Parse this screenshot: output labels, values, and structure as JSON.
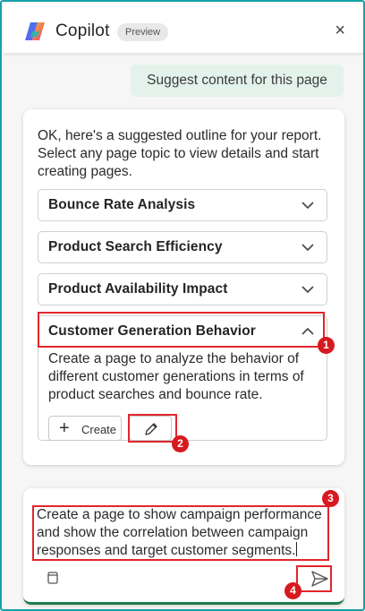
{
  "header": {
    "title": "Copilot",
    "badge": "Preview",
    "close_glyph": "×",
    "logo_icon": "copilot-logo"
  },
  "user_message": "Suggest content for this page",
  "reply": {
    "intro": "OK, here's a suggested outline for your report. Select any page topic to view details and start creating pages.",
    "topics": [
      {
        "label": "Bounce Rate Analysis",
        "expanded": false
      },
      {
        "label": "Product Search Efficiency",
        "expanded": false
      },
      {
        "label": "Product Availability Impact",
        "expanded": false
      },
      {
        "label": "Customer Generation Behavior",
        "expanded": true,
        "description": "Create a page to analyze the behavior of different customer generations in terms of product searches and bounce rate."
      }
    ],
    "create_label": "Create",
    "create_glyph": "+",
    "edit_icon": "pencil-icon"
  },
  "input": {
    "text": "Create a page to show campaign performance and show the correlation between campaign responses and target customer segments.",
    "attach_icon": "notebook-icon",
    "send_icon": "send-icon"
  },
  "callouts": [
    "1",
    "2",
    "3",
    "4"
  ],
  "colors": {
    "frame": "#16a2a8",
    "user_bubble": "#e3f3ec",
    "highlight": "#e1262b",
    "callout": "#d71920",
    "input_accent": "#1f7a4a"
  }
}
